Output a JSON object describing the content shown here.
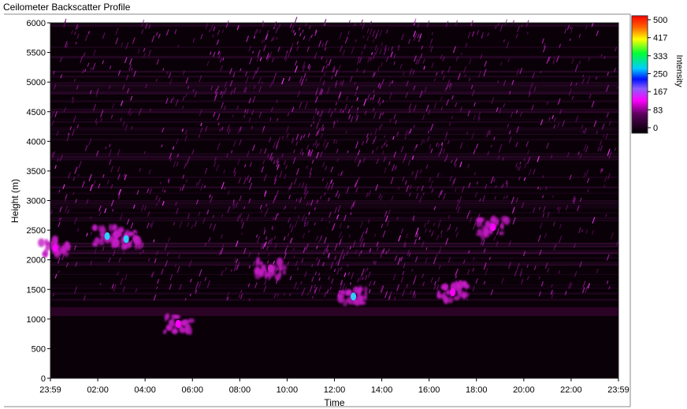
{
  "window": {
    "title": "Ceilometer Backscatter Profile"
  },
  "colors": {
    "background": "#000000",
    "low": "#2a0026",
    "mid": "#c41fc4",
    "high": "#ff00ff",
    "peak": "#33ccff"
  },
  "chart_data": {
    "type": "heatmap",
    "title": "Ceilometer Backscatter Profile",
    "xlabel": "Time",
    "ylabel": "Height (m)",
    "colorbar_label": "Intensity",
    "x_ticks": [
      "23:59",
      "02:00",
      "04:00",
      "06:00",
      "08:00",
      "10:00",
      "12:00",
      "14:00",
      "16:00",
      "18:00",
      "20:00",
      "22:00",
      "23:59"
    ],
    "y_ticks": [
      0,
      500,
      1000,
      1500,
      2000,
      2500,
      3000,
      3500,
      4000,
      4500,
      5000,
      5500,
      6000
    ],
    "xlim": [
      "23:59",
      "23:59"
    ],
    "ylim": [
      0,
      6000
    ],
    "colorbar_ticks": [
      0,
      83,
      167,
      250,
      333,
      417,
      500
    ],
    "colorbar_range": [
      0,
      500
    ],
    "features": [
      {
        "time_h": 0.2,
        "height_m": 2200,
        "intensity": 200
      },
      {
        "time_h": 2.4,
        "height_m": 2400,
        "intensity": 250
      },
      {
        "time_h": 3.2,
        "height_m": 2350,
        "intensity": 260
      },
      {
        "time_h": 5.4,
        "height_m": 920,
        "intensity": 180
      },
      {
        "time_h": 9.3,
        "height_m": 1850,
        "intensity": 140
      },
      {
        "time_h": 12.8,
        "height_m": 1380,
        "intensity": 240
      },
      {
        "time_h": 17.0,
        "height_m": 1450,
        "intensity": 200
      },
      {
        "time_h": 18.7,
        "height_m": 2550,
        "intensity": 220
      }
    ]
  }
}
